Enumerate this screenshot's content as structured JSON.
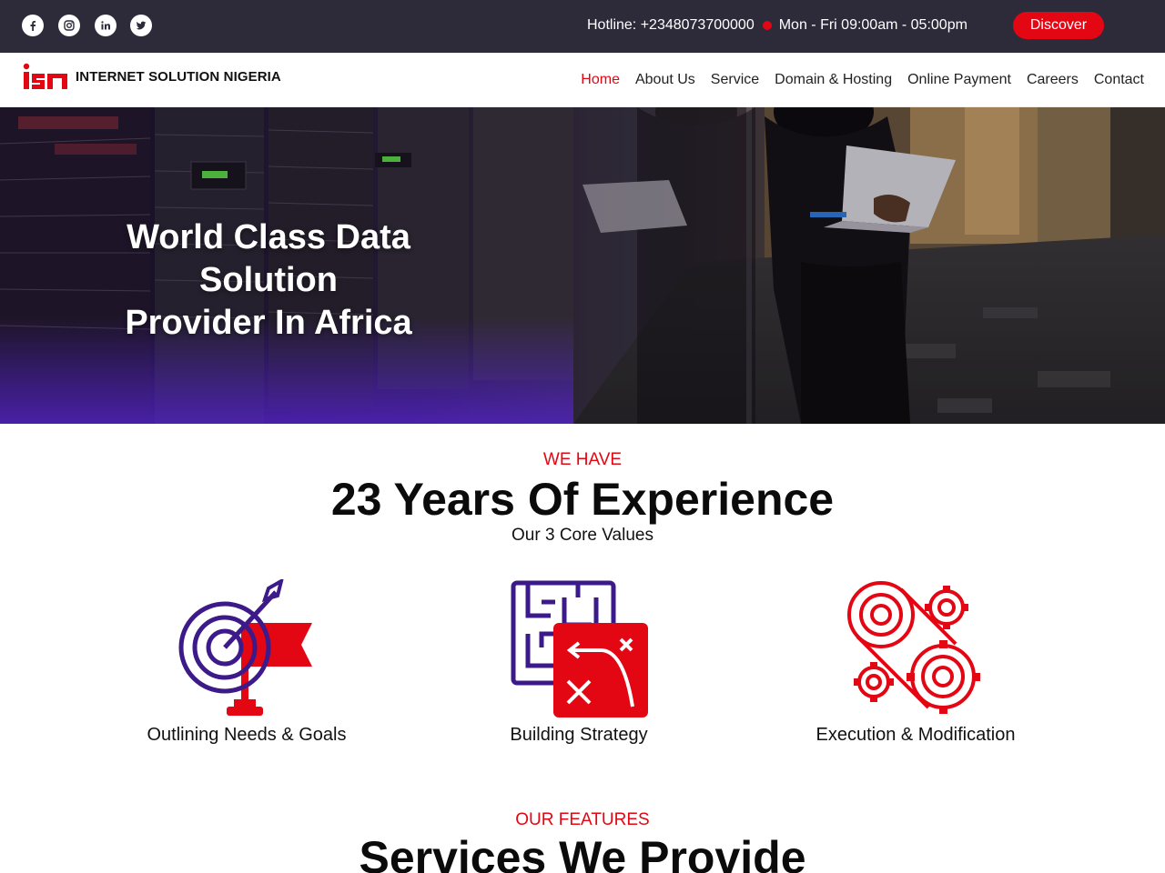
{
  "topbar": {
    "social": [
      "facebook-icon",
      "instagram-icon",
      "linkedin-icon",
      "twitter-icon"
    ],
    "hotline": "Hotline: +2348073700000",
    "hours": "Mon - Fri 09:00am - 05:00pm",
    "discover_label": "Discover"
  },
  "brand": {
    "logo_mark": "isn",
    "name": "INTERNET SOLUTION NIGERIA",
    "accent": "#e30613",
    "dark": "#2d2a3a",
    "purple": "#3d1a8a"
  },
  "nav": {
    "items": [
      "Home",
      "About Us",
      "Service",
      "Domain & Hosting",
      "Online Payment",
      "Careers",
      "Contact"
    ],
    "active": "Home"
  },
  "hero": {
    "line1": "World Class Data Solution",
    "line2": "Provider In Africa"
  },
  "experience": {
    "kicker": "WE HAVE",
    "title": "23 Years Of Experience",
    "subtitle": "Our 3 Core Values",
    "values": [
      {
        "label": "Outlining Needs & Goals",
        "icon": "target-flag-icon"
      },
      {
        "label": "Building Strategy",
        "icon": "maze-strategy-icon"
      },
      {
        "label": "Execution & Modification",
        "icon": "gears-icon"
      }
    ]
  },
  "features": {
    "kicker": "OUR FEATURES",
    "title": "Services We Provide"
  }
}
